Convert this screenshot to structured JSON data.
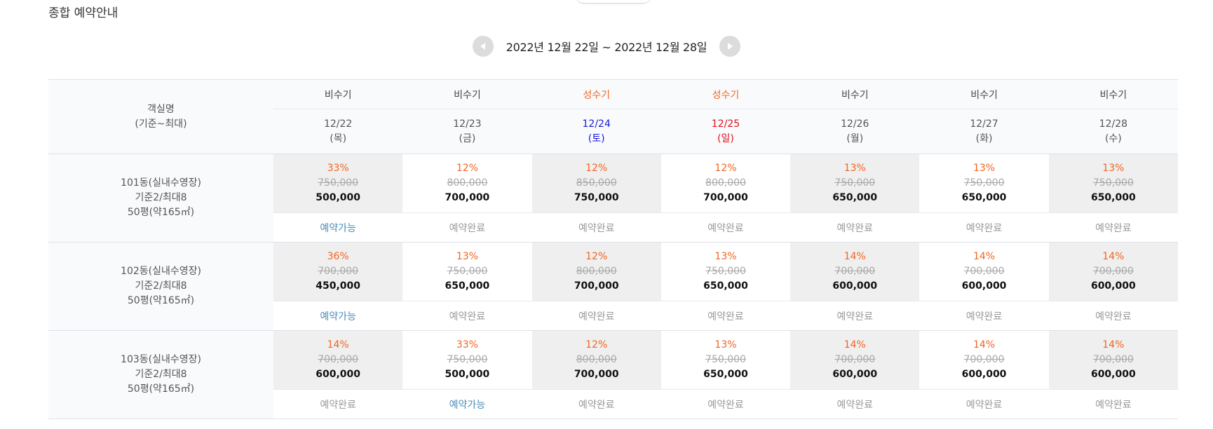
{
  "page": {
    "title": "종합 예약안내"
  },
  "nav": {
    "range": "2022년 12월 22일 ~ 2022년 12월 28일"
  },
  "colors": {
    "accent_orange": "#f26522",
    "available_blue": "#4a8cb8",
    "saturday_blue": "#1a1ad6",
    "sunday_red": "#e0101a"
  },
  "icons": {
    "prev": "chevron-left-icon",
    "next": "chevron-right-icon"
  },
  "header": {
    "room_line1": "객실명",
    "room_line2": "(기준~최대)",
    "seasons": [
      "비수기",
      "비수기",
      "성수기",
      "성수기",
      "비수기",
      "비수기",
      "비수기"
    ],
    "season_types": [
      "off",
      "off",
      "peak",
      "peak",
      "off",
      "off",
      "off"
    ],
    "dates": [
      "12/22",
      "12/23",
      "12/24",
      "12/25",
      "12/26",
      "12/27",
      "12/28"
    ],
    "weekdays": [
      "(목)",
      "(금)",
      "(토)",
      "(일)",
      "(월)",
      "(화)",
      "(수)"
    ],
    "day_types": [
      "weekday",
      "weekday",
      "sat",
      "sun",
      "weekday",
      "weekday",
      "weekday"
    ]
  },
  "rooms": [
    {
      "name": "101동(실내수영장)",
      "capacity": "기준2/최대8",
      "size": "50평(약165㎡)",
      "days": [
        {
          "discount": "33%",
          "original": "750,000",
          "price": "500,000",
          "status": "예약가능",
          "available": true
        },
        {
          "discount": "12%",
          "original": "800,000",
          "price": "700,000",
          "status": "예약완료",
          "available": false
        },
        {
          "discount": "12%",
          "original": "850,000",
          "price": "750,000",
          "status": "예약완료",
          "available": false
        },
        {
          "discount": "12%",
          "original": "800,000",
          "price": "700,000",
          "status": "예약완료",
          "available": false
        },
        {
          "discount": "13%",
          "original": "750,000",
          "price": "650,000",
          "status": "예약완료",
          "available": false
        },
        {
          "discount": "13%",
          "original": "750,000",
          "price": "650,000",
          "status": "예약완료",
          "available": false
        },
        {
          "discount": "13%",
          "original": "750,000",
          "price": "650,000",
          "status": "예약완료",
          "available": false
        }
      ]
    },
    {
      "name": "102동(실내수영장)",
      "capacity": "기준2/최대8",
      "size": "50평(약165㎡)",
      "days": [
        {
          "discount": "36%",
          "original": "700,000",
          "price": "450,000",
          "status": "예약가능",
          "available": true
        },
        {
          "discount": "13%",
          "original": "750,000",
          "price": "650,000",
          "status": "예약완료",
          "available": false
        },
        {
          "discount": "12%",
          "original": "800,000",
          "price": "700,000",
          "status": "예약완료",
          "available": false
        },
        {
          "discount": "13%",
          "original": "750,000",
          "price": "650,000",
          "status": "예약완료",
          "available": false
        },
        {
          "discount": "14%",
          "original": "700,000",
          "price": "600,000",
          "status": "예약완료",
          "available": false
        },
        {
          "discount": "14%",
          "original": "700,000",
          "price": "600,000",
          "status": "예약완료",
          "available": false
        },
        {
          "discount": "14%",
          "original": "700,000",
          "price": "600,000",
          "status": "예약완료",
          "available": false
        }
      ]
    },
    {
      "name": "103동(실내수영장)",
      "capacity": "기준2/최대8",
      "size": "50평(약165㎡)",
      "days": [
        {
          "discount": "14%",
          "original": "700,000",
          "price": "600,000",
          "status": "예약완료",
          "available": false
        },
        {
          "discount": "33%",
          "original": "750,000",
          "price": "500,000",
          "status": "예약가능",
          "available": true
        },
        {
          "discount": "12%",
          "original": "800,000",
          "price": "700,000",
          "status": "예약완료",
          "available": false
        },
        {
          "discount": "13%",
          "original": "750,000",
          "price": "650,000",
          "status": "예약완료",
          "available": false
        },
        {
          "discount": "14%",
          "original": "700,000",
          "price": "600,000",
          "status": "예약완료",
          "available": false
        },
        {
          "discount": "14%",
          "original": "700,000",
          "price": "600,000",
          "status": "예약완료",
          "available": false
        },
        {
          "discount": "14%",
          "original": "700,000",
          "price": "600,000",
          "status": "예약완료",
          "available": false
        }
      ]
    }
  ]
}
